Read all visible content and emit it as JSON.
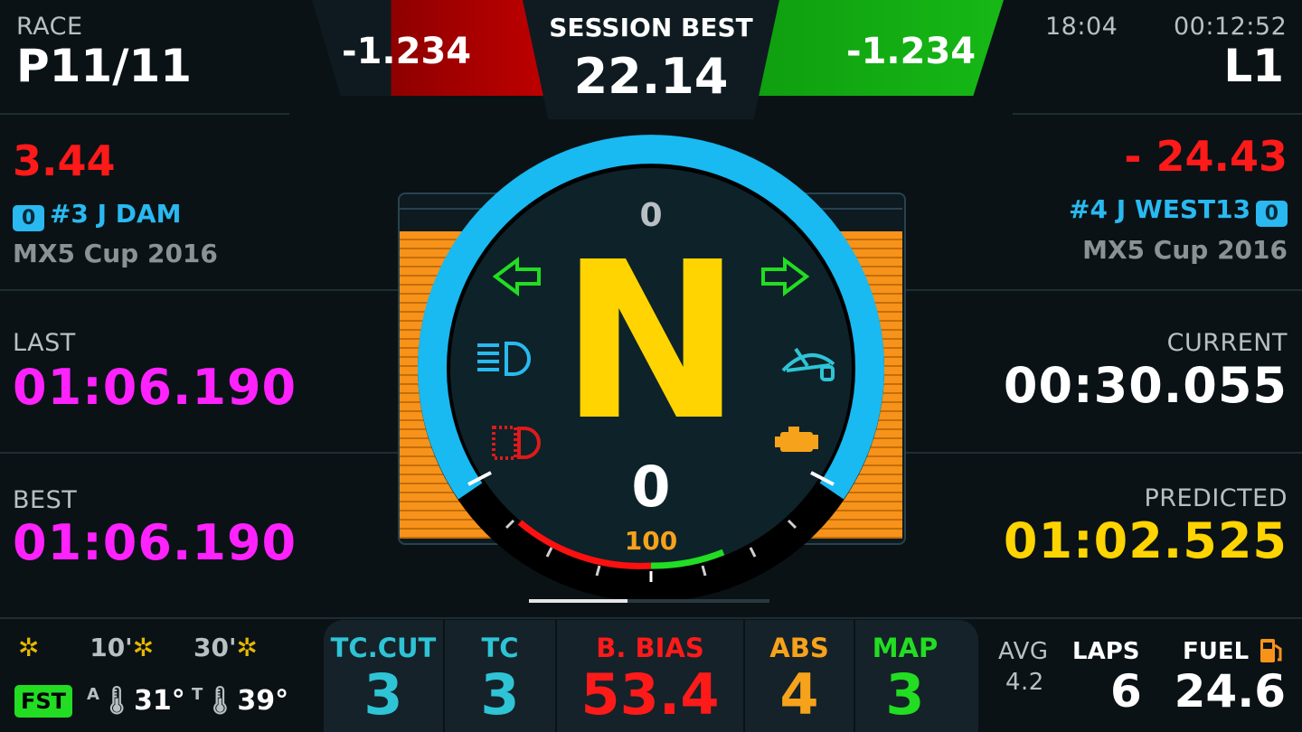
{
  "race": {
    "label": "RACE",
    "position": "P11/11"
  },
  "delta_left": "-1.234",
  "session_best": {
    "label": "SESSION BEST",
    "value": "22.14"
  },
  "delta_right": "-1.234",
  "clock": {
    "time_of_day": "18:04",
    "session_time": "00:12:52",
    "lap": "L1"
  },
  "ahead": {
    "gap": "3.44",
    "badge": "0",
    "driver": "#3 J DAM",
    "car": "MX5 Cup 2016"
  },
  "behind": {
    "gap": "- 24.43",
    "badge": "0",
    "driver": "#4 J WEST13",
    "car": "MX5 Cup 2016"
  },
  "last": {
    "label": "LAST",
    "value": "01:06.190"
  },
  "best": {
    "label": "BEST",
    "value": "01:06.190"
  },
  "current": {
    "label": "CURRENT",
    "value": "00:30.055"
  },
  "predicted": {
    "label": "PREDICTED",
    "value": "01:02.525"
  },
  "gauge": {
    "rpm": "0",
    "gear": "N",
    "speed": "0",
    "throttle": "100",
    "shift_light_fraction": 0.0
  },
  "weather": {
    "now_label": "",
    "t10_label": "10'",
    "t30_label": "30'",
    "grip": "FST",
    "air_temp": "31°",
    "track_temp": "39°",
    "air_prefix": "A",
    "track_prefix": "T"
  },
  "settings": [
    {
      "label": "TC.CUT",
      "value": "3",
      "color": "#2ec4d6"
    },
    {
      "label": "TC",
      "value": "3",
      "color": "#2ec4d6"
    },
    {
      "label": "B. BIAS",
      "value": "53.4",
      "color": "#ff1a1a"
    },
    {
      "label": "ABS",
      "value": "4",
      "color": "#f7a21b"
    },
    {
      "label": "MAP",
      "value": "3",
      "color": "#22dd22"
    }
  ],
  "fuel": {
    "avg_label": "AVG",
    "avg_value": "4.2",
    "laps_label": "LAPS",
    "laps_value": "6",
    "fuel_label": "FUEL",
    "fuel_value": "24.6"
  },
  "colors": {
    "accent_blue": "#29b9f0",
    "magenta": "#ff22ff",
    "yellow": "#ffd400",
    "red": "#ff1a1a",
    "green": "#22cc22",
    "orange": "#f7931a"
  }
}
